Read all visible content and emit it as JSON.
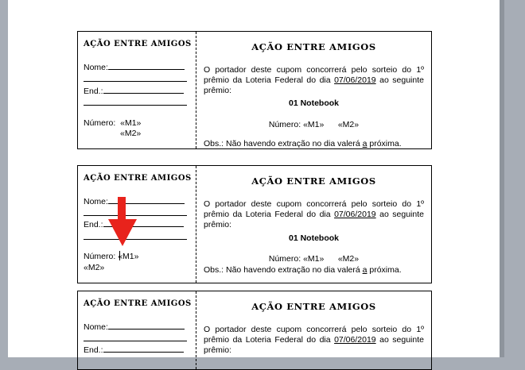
{
  "coupon": {
    "title": "AÇÃO ENTRE AMIGOS",
    "nome_label": "Nome:",
    "end_label": "End.:",
    "numero_label": "Número:",
    "m1": "«M1»",
    "m2": "«M2»",
    "text_part1": "O portador deste cupom concorrerá pelo sorteio do 1º prêmio da Loteria Federal do dia ",
    "date": "07/06/2019",
    "text_part2": " ao seguinte prêmio:",
    "prize": "01 Notebook",
    "numero_main_label": "Número:",
    "obs_part1": "Obs.: Não havendo extração no dia valerá ",
    "obs_a": "a",
    "obs_part2": " próxima."
  },
  "colors": {
    "background": "#a7adb6",
    "page": "#ffffff",
    "arrow": "#e8231c"
  }
}
